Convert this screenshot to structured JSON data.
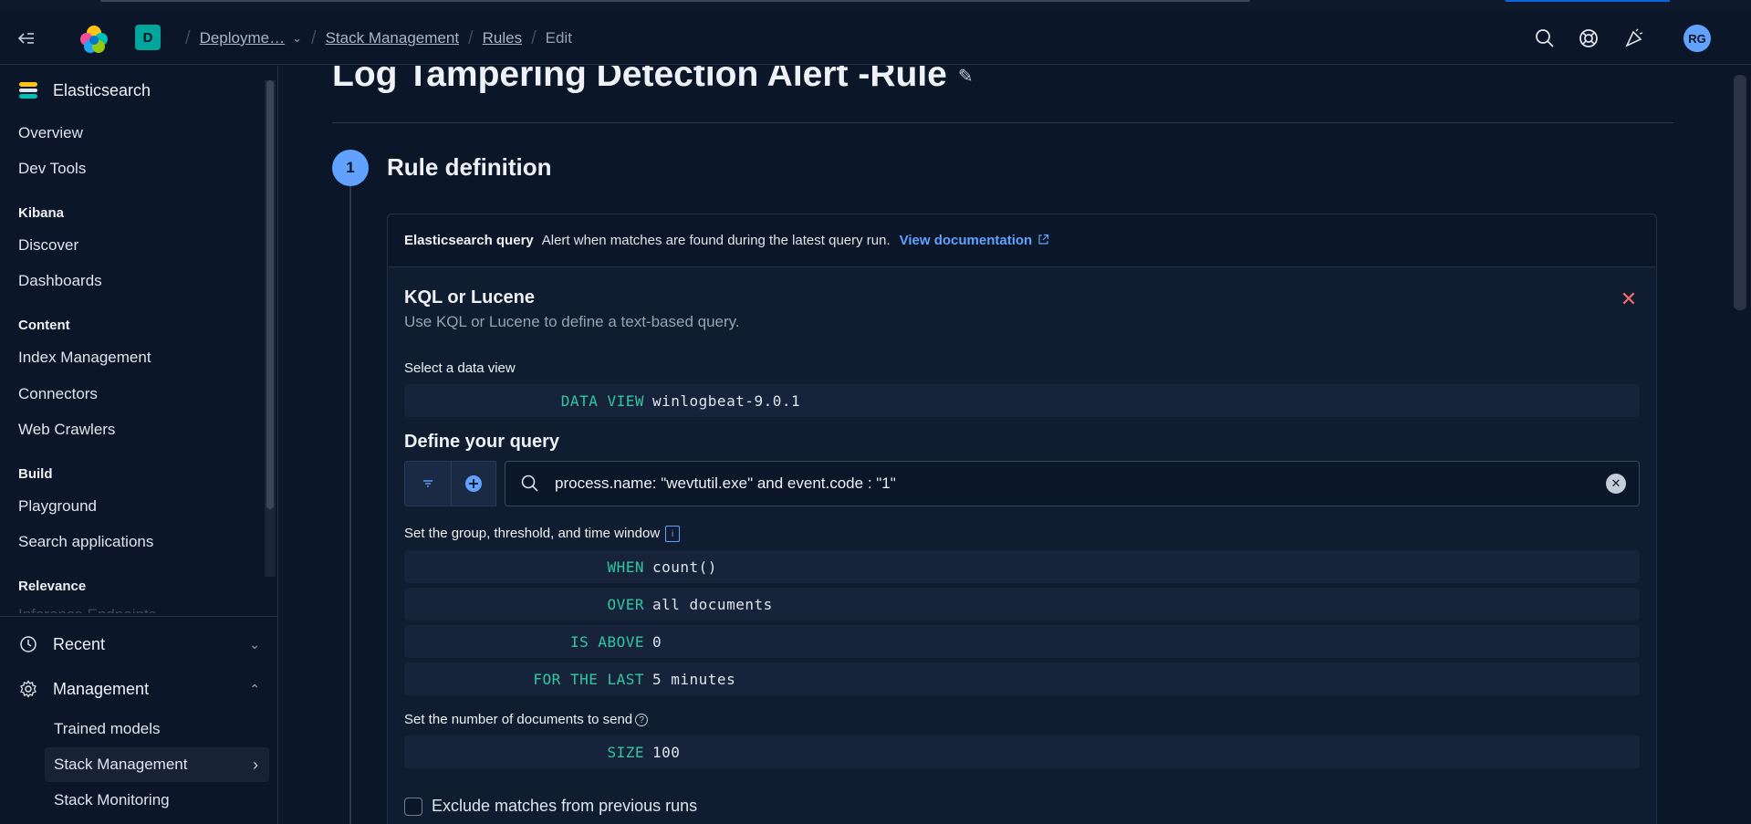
{
  "header": {
    "space_initial": "D",
    "breadcrumbs": [
      {
        "label": "Deployme…"
      },
      {
        "label": "Stack Management"
      },
      {
        "label": "Rules"
      },
      {
        "label": "Edit"
      }
    ],
    "avatar_initials": "RG",
    "icons": [
      "menu-collapse-icon",
      "elastic-logo",
      "search-icon",
      "help-icon",
      "news-feed-icon"
    ]
  },
  "sidebar": {
    "section_title": "Elasticsearch",
    "items_top": [
      "Overview",
      "Dev Tools"
    ],
    "groups": [
      {
        "name": "Kibana",
        "items": [
          "Discover",
          "Dashboards"
        ]
      },
      {
        "name": "Content",
        "items": [
          "Index Management",
          "Connectors",
          "Web Crawlers"
        ]
      },
      {
        "name": "Build",
        "items": [
          "Playground",
          "Search applications"
        ]
      },
      {
        "name": "Relevance",
        "items": [
          "Inference Endpoints"
        ]
      }
    ],
    "recent_label": "Recent",
    "management_label": "Management",
    "management_items": [
      "Trained models",
      "Stack Management",
      "Stack Monitoring"
    ]
  },
  "main": {
    "page_title": "Log Tampering Detection Alert -Rule",
    "step_number": "1",
    "step_title": "Rule definition",
    "rule_type": {
      "name": "Elasticsearch query",
      "description": "Alert when matches are found during the latest query run.",
      "doc_link": "View documentation"
    },
    "query_type": {
      "title": "KQL or Lucene",
      "subtitle": "Use KQL or Lucene to define a text-based query."
    },
    "data_view": {
      "label": "Select a data view",
      "key": "DATA VIEW",
      "value": "winlogbeat-9.0.1"
    },
    "define_query": {
      "title": "Define your query",
      "query": "process.name: \"wevtutil.exe\" and event.code : \"1\""
    },
    "threshold": {
      "label": "Set the group, threshold, and time window",
      "rows": [
        {
          "key": "WHEN",
          "value": "count()"
        },
        {
          "key": "OVER",
          "value": "all documents"
        },
        {
          "key": "IS ABOVE",
          "value": "0"
        },
        {
          "key": "FOR THE LAST",
          "value": "5 minutes"
        }
      ]
    },
    "size": {
      "label": "Set the number of documents to send",
      "key": "SIZE",
      "value": "100"
    },
    "exclude_label": "Exclude matches from previous runs"
  },
  "colors": {
    "background": "#0b1628",
    "accent": "#61a2ff",
    "keyword": "#2fc8a3",
    "danger": "#f26d6d",
    "space_badge": "#00a69b"
  }
}
